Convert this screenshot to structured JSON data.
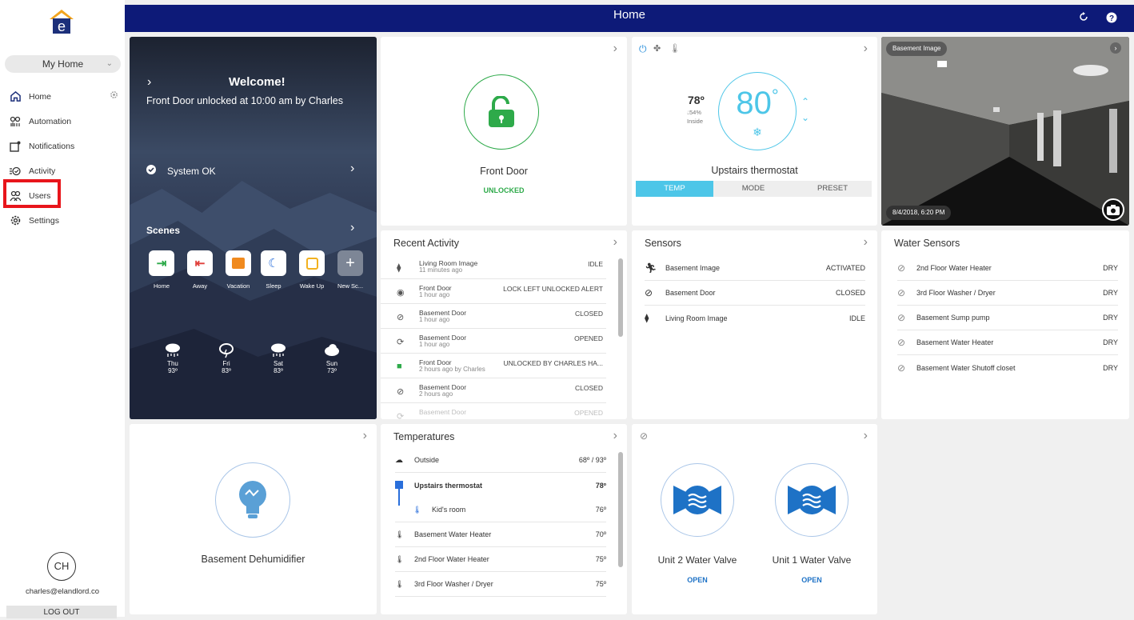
{
  "header": {
    "title": "Home"
  },
  "sidebar": {
    "home_selector": "My Home",
    "items": [
      {
        "label": "Home"
      },
      {
        "label": "Automation"
      },
      {
        "label": "Notifications"
      },
      {
        "label": "Activity"
      },
      {
        "label": "Users"
      },
      {
        "label": "Settings"
      }
    ],
    "avatar_initials": "CH",
    "email": "charles@elandlord.co",
    "logout": "LOG OUT"
  },
  "welcome": {
    "heading": "Welcome!",
    "message": "Front Door unlocked at 10:00 am by Charles",
    "system_status": "System OK",
    "scenes_title": "Scenes",
    "scenes": [
      {
        "label": "Home",
        "icon": "home-arrive-icon",
        "color": "#2eaa4a"
      },
      {
        "label": "Away",
        "icon": "home-leave-icon",
        "color": "#e0403b"
      },
      {
        "label": "Vacation",
        "icon": "vacation-icon",
        "color": "#f08a1e"
      },
      {
        "label": "Sleep",
        "icon": "moon-icon",
        "color": "#2a6fdb"
      },
      {
        "label": "Wake Up",
        "icon": "alarm-clock-icon",
        "color": "#f2b11e"
      },
      {
        "label": "New Sc...",
        "icon": "plus-icon",
        "color": "#ffffff"
      }
    ],
    "weather": [
      {
        "day": "Thu",
        "temp": "93º",
        "icon": "rain-icon"
      },
      {
        "day": "Fri",
        "temp": "83º",
        "icon": "thunderstorm-icon"
      },
      {
        "day": "Sat",
        "temp": "83º",
        "icon": "rain-icon"
      },
      {
        "day": "Sun",
        "temp": "73º",
        "icon": "cloud-icon"
      }
    ]
  },
  "front_door": {
    "name": "Front Door",
    "status": "UNLOCKED",
    "accent": "#2eaa4a"
  },
  "thermostat": {
    "inside_temp": "78º",
    "humidity": "54%",
    "inside_label": "Inside",
    "setpoint": "80",
    "name": "Upstairs thermostat",
    "tabs": [
      "TEMP",
      "MODE",
      "PRESET"
    ],
    "active_tab": "TEMP",
    "accent": "#4dc6e8"
  },
  "camera": {
    "label": "Basement Image",
    "timestamp": "8/4/2018, 6:20 PM"
  },
  "recent_activity": {
    "title": "Recent Activity",
    "rows": [
      {
        "name": "Living Room Image",
        "time": "11 minutes ago",
        "status": "IDLE",
        "icon": "motion-sensor-icon"
      },
      {
        "name": "Front Door",
        "time": "1 hour ago",
        "status": "LOCK LEFT UNLOCKED ALERT",
        "icon": "alert-icon"
      },
      {
        "name": "Basement Door",
        "time": "1 hour ago",
        "status": "CLOSED",
        "icon": "door-sensor-icon"
      },
      {
        "name": "Basement Door",
        "time": "1 hour ago",
        "status": "OPENED",
        "icon": "door-open-icon"
      },
      {
        "name": "Front Door",
        "time": "2 hours ago by Charles",
        "status": "UNLOCKED BY CHARLES HA...",
        "icon": "lock-open-icon"
      },
      {
        "name": "Basement Door",
        "time": "2 hours ago",
        "status": "CLOSED",
        "icon": "door-sensor-icon"
      },
      {
        "name": "Basement Door",
        "time": "",
        "status": "OPENED",
        "icon": "door-open-icon"
      }
    ]
  },
  "sensors": {
    "title": "Sensors",
    "rows": [
      {
        "name": "Basement Image",
        "status": "ACTIVATED",
        "icon": "running-person-icon"
      },
      {
        "name": "Basement Door",
        "status": "CLOSED",
        "icon": "door-sensor-icon"
      },
      {
        "name": "Living Room Image",
        "status": "IDLE",
        "icon": "motion-sensor-icon"
      }
    ]
  },
  "water_sensors": {
    "title": "Water Sensors",
    "rows": [
      {
        "name": "2nd Floor Water Heater",
        "status": "DRY"
      },
      {
        "name": "3rd Floor Washer / Dryer",
        "status": "DRY"
      },
      {
        "name": "Basement Sump pump",
        "status": "DRY"
      },
      {
        "name": "Basement Water Heater",
        "status": "DRY"
      },
      {
        "name": "Basement Water Shutoff closet",
        "status": "DRY"
      }
    ]
  },
  "dehumidifier": {
    "name": "Basement Dehumidifier"
  },
  "temperatures": {
    "title": "Temperatures",
    "rows": [
      {
        "name": "Outside",
        "value": "68º / 93º",
        "icon": "rain-icon"
      },
      {
        "name": "Upstairs thermostat",
        "value": "78º",
        "icon": "thermostat-icon"
      },
      {
        "name": "Kid's room",
        "value": "76º",
        "icon": "thermometer-icon"
      },
      {
        "name": "Basement Water Heater",
        "value": "70º",
        "icon": "thermometer-icon"
      },
      {
        "name": "2nd Floor Water Heater",
        "value": "75º",
        "icon": "thermometer-icon"
      },
      {
        "name": "3rd Floor Washer / Dryer",
        "value": "75º",
        "icon": "thermometer-icon"
      }
    ]
  },
  "valves": {
    "items": [
      {
        "name": "Unit 2 Water Valve",
        "status": "OPEN"
      },
      {
        "name": "Unit 1 Water Valve",
        "status": "OPEN"
      }
    ],
    "accent": "#1e72c6"
  }
}
